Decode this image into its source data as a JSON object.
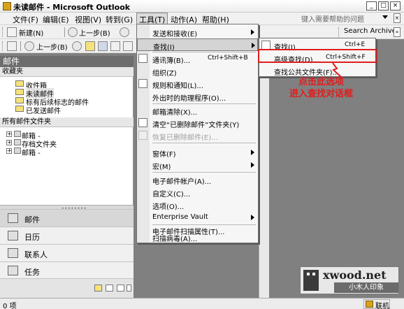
{
  "window": {
    "title": "未读邮件 - Microsoft Outlook",
    "minimize": "_",
    "maximize": "□",
    "close": "×"
  },
  "menubar": {
    "items": [
      "文件(F)",
      "编辑(E)",
      "视图(V)",
      "转到(G)",
      "工具(T)",
      "动作(A)",
      "帮助(H)"
    ],
    "help_placeholder": "键入需要帮助的问题"
  },
  "toolbar1": {
    "new_label": "新建(N)",
    "back_label": "上一步(B)",
    "search_archive": "Search Archive"
  },
  "toolbar2": {
    "back_label": "上一步(B)"
  },
  "nav": {
    "header": "邮件",
    "favorites_title": "收藏夹",
    "favorites": [
      "收件箱",
      "未读邮件",
      "标有后续标志的邮件",
      "已发送邮件"
    ],
    "all_title": "所有邮件文件夹",
    "tree": [
      "邮箱 -",
      "存档文件夹",
      "邮箱 -"
    ],
    "buttons": [
      "邮件",
      "日历",
      "联系人",
      "任务"
    ]
  },
  "tools_menu": {
    "items": [
      {
        "label": "发送和接收(E)",
        "shortcut": "",
        "submenu": true,
        "disabled": false
      },
      {
        "label": "查找(I)",
        "shortcut": "",
        "submenu": true,
        "disabled": false
      },
      {
        "label": "通讯簿(B)...",
        "shortcut": "Ctrl+Shift+B",
        "submenu": false,
        "disabled": false
      },
      {
        "label": "组织(Z)",
        "shortcut": "",
        "submenu": false,
        "disabled": false
      },
      {
        "label": "规则和通知(L)...",
        "shortcut": "",
        "submenu": false,
        "disabled": false
      },
      {
        "label": "外出时的助理程序(O)...",
        "shortcut": "",
        "submenu": false,
        "disabled": false
      },
      {
        "label": "邮箱清除(X)...",
        "shortcut": "",
        "submenu": false,
        "disabled": false
      },
      {
        "label": "清空“已删除邮件”文件夹(Y)",
        "shortcut": "",
        "submenu": false,
        "disabled": false
      },
      {
        "label": "恢复已删除邮件(E)...",
        "shortcut": "",
        "submenu": false,
        "disabled": true
      },
      {
        "label": "窗体(F)",
        "shortcut": "",
        "submenu": true,
        "disabled": false
      },
      {
        "label": "宏(M)",
        "shortcut": "",
        "submenu": true,
        "disabled": false
      },
      {
        "label": "电子邮件帐户(A)...",
        "shortcut": "",
        "submenu": false,
        "disabled": false
      },
      {
        "label": "自定义(C)...",
        "shortcut": "",
        "submenu": false,
        "disabled": false
      },
      {
        "label": "选项(O)...",
        "shortcut": "",
        "submenu": false,
        "disabled": false
      },
      {
        "label": "Enterprise Vault",
        "shortcut": "",
        "submenu": true,
        "disabled": false
      },
      {
        "label": "电子邮件扫描属性(T)...",
        "shortcut": "",
        "submenu": false,
        "disabled": false
      },
      {
        "label": "扫描病毒(A)...",
        "shortcut": "",
        "submenu": false,
        "disabled": false
      }
    ]
  },
  "find_submenu": {
    "items": [
      {
        "label": "查找(I)",
        "shortcut": "Ctrl+E"
      },
      {
        "label": "高级查找(D)...",
        "shortcut": "Ctrl+Shift+F"
      },
      {
        "label": "查找公共文件夹(F)...",
        "shortcut": ""
      }
    ]
  },
  "annotation": {
    "line1": "点击此选项",
    "line2": "进入查找对话框"
  },
  "watermark": {
    "brand": "xwood.net",
    "sub": "小木人印象"
  },
  "status": {
    "left": "0 项",
    "right": "联机"
  }
}
